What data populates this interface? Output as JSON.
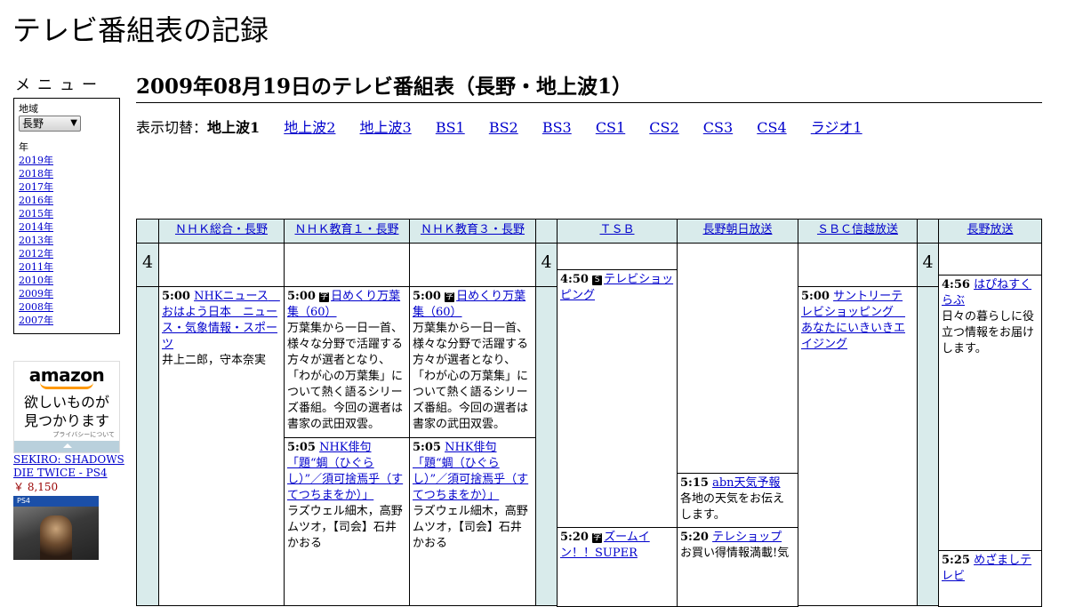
{
  "site_title": "テレビ番組表の記録",
  "sidebar": {
    "menu_title": "メニュー",
    "region_label": "地域",
    "region_value": "長野",
    "year_label": "年",
    "years": [
      "2019年",
      "2018年",
      "2017年",
      "2016年",
      "2015年",
      "2014年",
      "2013年",
      "2012年",
      "2011年",
      "2010年",
      "2009年",
      "2008年",
      "2007年"
    ]
  },
  "ad": {
    "logo": "amazon",
    "text_line1": "欲しいものが",
    "text_line2": "見つかります",
    "privacy": "プライバシーについて",
    "product_title": "SEKIRO: SHADOWS DIE TWICE - PS4",
    "product_price": "￥ 8,150",
    "cover_band": "PS4"
  },
  "page_heading": "2009年08月19日のテレビ番組表（長野・地上波1）",
  "switcher": {
    "label": "表示切替：",
    "active": "地上波1",
    "links": [
      "地上波2",
      "地上波3",
      "BS1",
      "BS2",
      "BS3",
      "CS1",
      "CS2",
      "CS3",
      "CS4",
      "ラジオ1"
    ]
  },
  "channels": [
    "ＮＨＫ総合・長野",
    "ＮＨＫ教育１・長野",
    "ＮＨＫ教育３・長野",
    "ＴＳＢ",
    "長野朝日放送",
    "ＳＢＣ信越放送",
    "長野放送"
  ],
  "hour": "4",
  "programs": {
    "p1": {
      "time": "5:00",
      "title": "NHKニュース　おはよう日本　ニュース・気象情報・スポーツ",
      "desc": "井上二郎，守本奈実"
    },
    "p2": {
      "time": "5:00",
      "icon": "字",
      "title": "日めくり万葉集（60）",
      "desc": "万葉集から一日一首、様々な分野で活躍する方々が選者となり、「わが心の万葉集」について熱く語るシリーズ番組。今回の選者は書家の武田双雲。"
    },
    "p3": {
      "time": "5:05",
      "title": "NHK俳句「題“蜩（ひぐらし）”／須可捨焉乎（すてつちまをか）」",
      "desc": "ラズウェル細木，高野ムツオ，【司会】石井かおる"
    },
    "p4": {
      "time": "5:00",
      "icon": "字",
      "title": "日めくり万葉集（60）",
      "desc": "万葉集から一日一首、様々な分野で活躍する方々が選者となり、「わが心の万葉集」について熱く語るシリーズ番組。今回の選者は書家の武田双雲。"
    },
    "p5": {
      "time": "5:05",
      "title": "NHK俳句「題“蜩（ひぐらし）”／須可捨焉乎（すてつちまをか）」",
      "desc": "ラズウェル細木，高野ムツオ，【司会】石井かおる"
    },
    "p6": {
      "time": "4:50",
      "icon": "S",
      "title": "テレビショッピング",
      "desc": ""
    },
    "p7": {
      "time": "5:20",
      "icon": "字",
      "title": "ズームイン！！SUPER",
      "desc": ""
    },
    "p8": {
      "time": "5:15",
      "title": "abn天気予報",
      "desc": "各地の天気をお伝えします。"
    },
    "p9": {
      "time": "5:20",
      "title": "テレショップ",
      "desc": "お買い得情報満載!気"
    },
    "p10": {
      "time": "5:00",
      "title": "サントリーテレビショッピング　あなたにいきいきエイジング",
      "desc": ""
    },
    "p11": {
      "time": "4:56",
      "title": "はぴねすくらぶ",
      "desc": "日々の暮らしに役立つ情報をお届けします。"
    },
    "p12": {
      "time": "5:25",
      "title": "めざましテレビ",
      "desc": ""
    }
  }
}
